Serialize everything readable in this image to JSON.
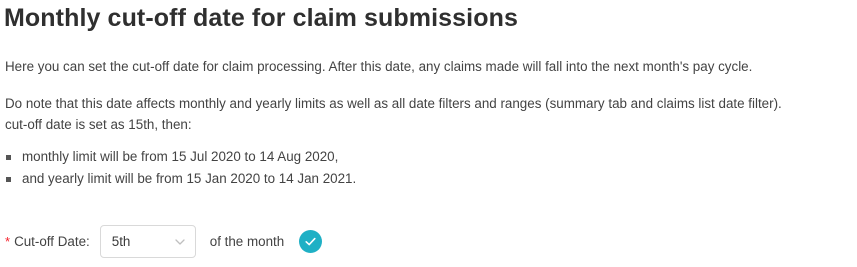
{
  "header": {
    "title": "Monthly cut-off date for claim submissions"
  },
  "content": {
    "intro": "Here you can set the cut-off date for claim processing. After this date, any claims made will fall into the next month's pay cycle.",
    "note_line1": "Do note that this date affects monthly and yearly limits as well as all date filters and ranges (summary tab and claims list date filter).",
    "note_line2": "cut-off date is set as 15th, then:",
    "bullets": [
      "monthly limit will be from 15 Jul 2020 to 14 Aug 2020,",
      "and yearly limit will be from 15 Jan 2020 to 14 Jan 2021."
    ]
  },
  "form": {
    "required_mark": "*",
    "label": "Cut-off Date",
    "colon": ":",
    "select_value": "5th",
    "suffix": "of the month",
    "icons": {
      "dropdown": "chevron-down-icon",
      "confirm": "check-circle-icon"
    }
  },
  "colors": {
    "accent": "#1fb0c5",
    "required": "#f5222d"
  }
}
